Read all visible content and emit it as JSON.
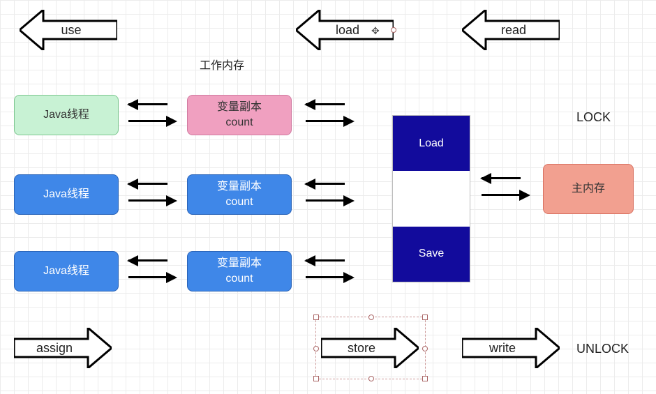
{
  "section_title": "工作内存",
  "top_arrows": {
    "use": "use",
    "load": "load",
    "read": "read"
  },
  "bottom_arrows": {
    "assign": "assign",
    "store": "store",
    "write": "write"
  },
  "side_labels": {
    "lock": "LOCK",
    "unlock": "UNLOCK"
  },
  "threads": [
    {
      "thread_label": "Java线程",
      "copy_label": "变量副本\ncount"
    },
    {
      "thread_label": "Java线程",
      "copy_label": "变量副本\ncount"
    },
    {
      "thread_label": "Java线程",
      "copy_label": "变量副本\ncount"
    }
  ],
  "vertical_stack": {
    "load": "Load",
    "save": "Save"
  },
  "main_memory": "主内存"
}
